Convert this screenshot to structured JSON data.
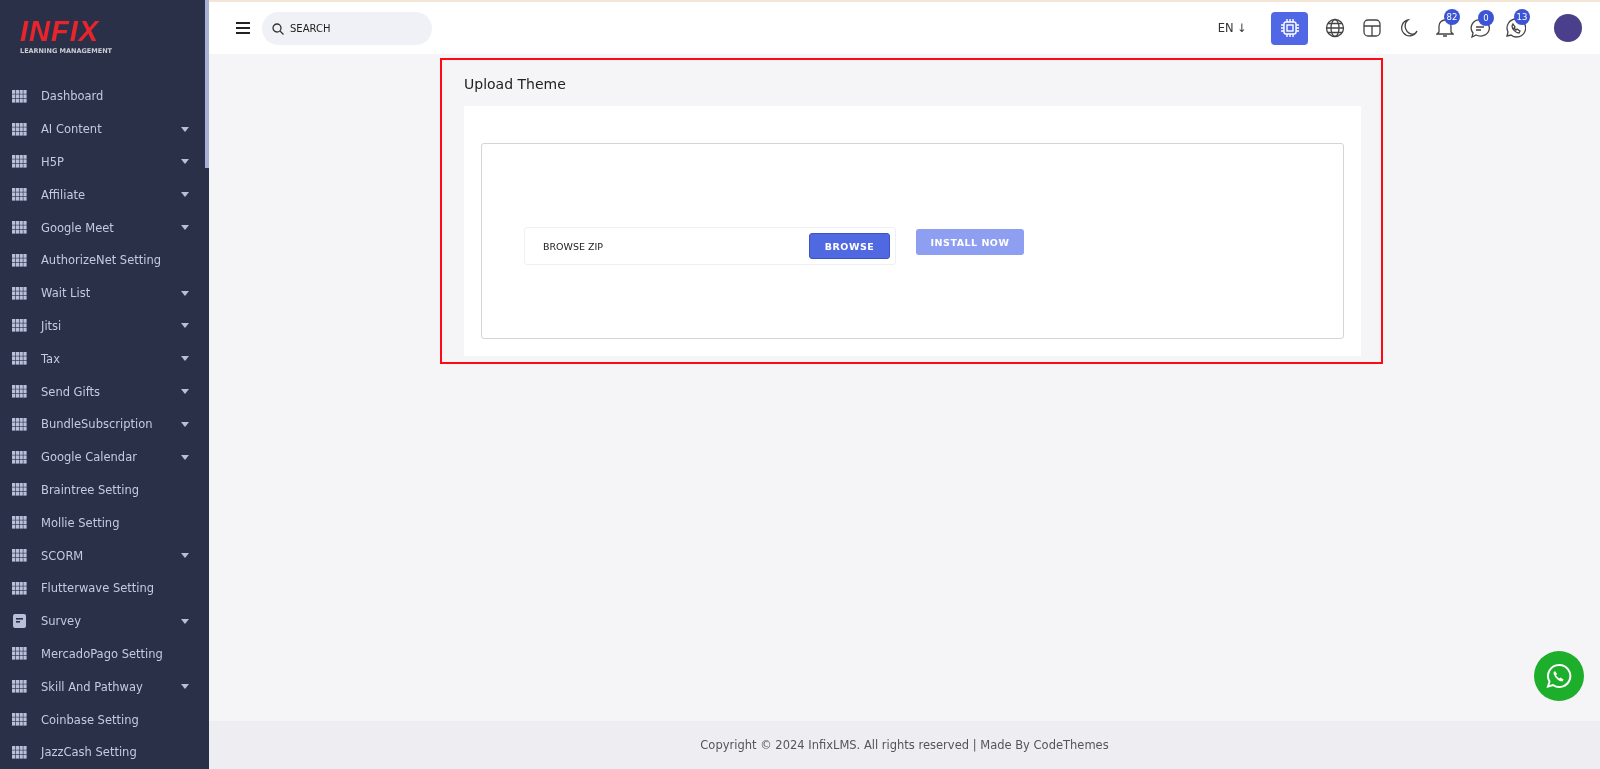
{
  "logo": {
    "wordmark": "INFIX",
    "tagline": "LEARNING MANAGEMENT"
  },
  "sidebar": {
    "items": [
      {
        "label": "Dashboard",
        "kind": "grid",
        "expandable": false
      },
      {
        "label": "AI Content",
        "kind": "grid",
        "expandable": true
      },
      {
        "label": "H5P",
        "kind": "grid",
        "expandable": true
      },
      {
        "label": "Affiliate",
        "kind": "grid",
        "expandable": true
      },
      {
        "label": "Google Meet",
        "kind": "grid",
        "expandable": true
      },
      {
        "label": "AuthorizeNet Setting",
        "kind": "grid",
        "expandable": false
      },
      {
        "label": "Wait List",
        "kind": "grid",
        "expandable": true
      },
      {
        "label": "Jitsi",
        "kind": "grid",
        "expandable": true
      },
      {
        "label": "Tax",
        "kind": "grid",
        "expandable": true
      },
      {
        "label": "Send Gifts",
        "kind": "grid",
        "expandable": true
      },
      {
        "label": "BundleSubscription",
        "kind": "grid",
        "expandable": true
      },
      {
        "label": "Google Calendar",
        "kind": "grid",
        "expandable": true
      },
      {
        "label": "Braintree Setting",
        "kind": "grid",
        "expandable": false
      },
      {
        "label": "Mollie Setting",
        "kind": "grid",
        "expandable": false
      },
      {
        "label": "SCORM",
        "kind": "grid",
        "expandable": true
      },
      {
        "label": "Flutterwave Setting",
        "kind": "grid",
        "expandable": false
      },
      {
        "label": "Survey",
        "kind": "form",
        "expandable": true
      },
      {
        "label": "MercadoPago Setting",
        "kind": "grid",
        "expandable": false
      },
      {
        "label": "Skill And Pathway",
        "kind": "grid",
        "expandable": true
      },
      {
        "label": "Coinbase Setting",
        "kind": "grid",
        "expandable": false
      },
      {
        "label": "JazzCash Setting",
        "kind": "grid",
        "expandable": false
      }
    ]
  },
  "header": {
    "search": {
      "placeholder": "SEARCH"
    },
    "language": "EN ↓",
    "badges": [
      {
        "kind": "bell",
        "count": "82"
      },
      {
        "kind": "chat",
        "count": "0"
      },
      {
        "kind": "phone",
        "count": "13"
      }
    ]
  },
  "upload": {
    "title": "Upload Theme",
    "file_field": {
      "placeholder": "BROWSE ZIP"
    },
    "browse_button": "BROWSE",
    "install_button": {
      "label": "INSTALL NOW",
      "disabled": true
    }
  },
  "footer": "Copyright © 2024 InfixLMS. All rights reserved | Made By CodeThemes"
}
